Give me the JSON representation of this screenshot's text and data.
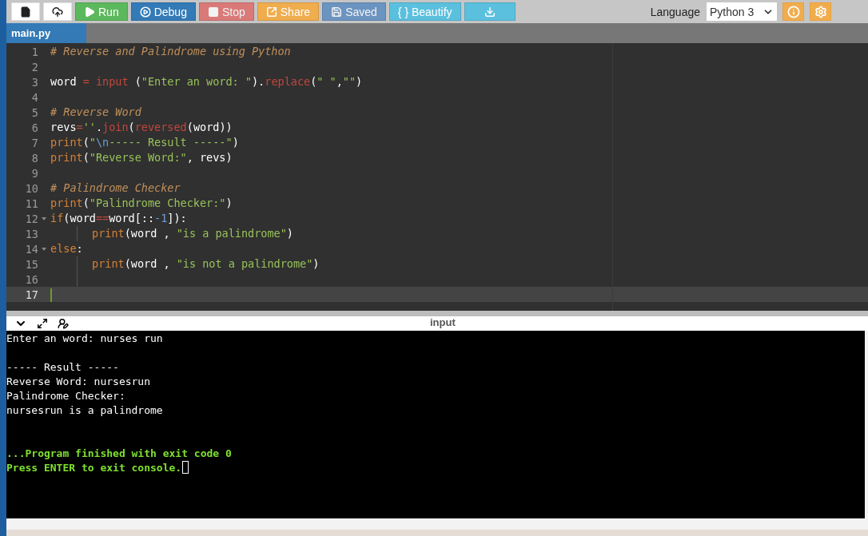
{
  "toolbar": {
    "buttons": [
      {
        "kind": "new-file",
        "color": "#ffffff",
        "disabled": false
      },
      {
        "kind": "upload",
        "color": "#ffffff",
        "disabled": false
      },
      {
        "kind": "run",
        "label": "Run",
        "color": "#5cb85c",
        "disabled": false
      },
      {
        "kind": "debug",
        "label": "Debug",
        "color": "#337ab7",
        "disabled": false
      },
      {
        "kind": "stop",
        "label": "Stop",
        "color": "#d97a78",
        "disabled": true
      },
      {
        "kind": "share",
        "label": "Share",
        "color": "#f0ad4e",
        "disabled": false
      },
      {
        "kind": "save",
        "label": "Saved",
        "color": "#6b94c0",
        "disabled": true
      },
      {
        "kind": "beautify",
        "label": "{ } Beautify",
        "color": "#5bc0de",
        "disabled": false
      },
      {
        "kind": "download",
        "color": "#5bc0de",
        "disabled": false
      }
    ],
    "language": {
      "label": "Language",
      "value": "Python 3"
    },
    "right_buttons": [
      {
        "kind": "info"
      },
      {
        "kind": "settings"
      }
    ]
  },
  "tabs": [
    {
      "label": "main.py",
      "selected": true
    }
  ],
  "editor": {
    "lines": [
      {
        "number": "1",
        "fold": false,
        "indented": false,
        "active": false,
        "tokens": [
          {
            "kind": "comment",
            "text": "# Reverse and Palindrome using Python"
          }
        ]
      },
      {
        "number": "2",
        "fold": false,
        "indented": false,
        "active": false
      },
      {
        "number": "3",
        "fold": false,
        "indented": false,
        "active": false,
        "tokens": [
          {
            "kind": "plain",
            "text": "word "
          },
          {
            "kind": "keyword",
            "text": "= input"
          },
          {
            "kind": "plain",
            "text": " ("
          },
          {
            "kind": "string",
            "text": "\"Enter an word: \""
          },
          {
            "kind": "plain",
            "text": ")."
          },
          {
            "kind": "keyword",
            "text": "replace"
          },
          {
            "kind": "plain",
            "text": "("
          },
          {
            "kind": "string",
            "text": "\" \""
          },
          {
            "kind": "plain",
            "text": ","
          },
          {
            "kind": "string",
            "text": "\"\""
          },
          {
            "kind": "plain",
            "text": ")"
          }
        ]
      },
      {
        "number": "4",
        "fold": false,
        "indented": false,
        "active": false
      },
      {
        "number": "5",
        "fold": false,
        "indented": false,
        "active": false,
        "tokens": [
          {
            "kind": "comment",
            "text": "# Reverse Word"
          }
        ]
      },
      {
        "number": "6",
        "fold": false,
        "indented": false,
        "active": false,
        "tokens": [
          {
            "kind": "plain",
            "text": "revs"
          },
          {
            "kind": "keyword",
            "text": "="
          },
          {
            "kind": "string",
            "text": "''"
          },
          {
            "kind": "plain",
            "text": "."
          },
          {
            "kind": "keyword",
            "text": "join"
          },
          {
            "kind": "plain",
            "text": "("
          },
          {
            "kind": "keyword",
            "text": "reversed"
          },
          {
            "kind": "plain",
            "text": "(word))"
          }
        ]
      },
      {
        "number": "7",
        "fold": false,
        "indented": false,
        "active": false,
        "tokens": [
          {
            "kind": "builtin",
            "text": "print"
          },
          {
            "kind": "plain",
            "text": "("
          },
          {
            "kind": "string",
            "text": "\""
          },
          {
            "kind": "escape",
            "text": "\\n"
          },
          {
            "kind": "string",
            "text": "----- Result -----\""
          },
          {
            "kind": "plain",
            "text": ")"
          }
        ]
      },
      {
        "number": "8",
        "fold": false,
        "indented": false,
        "active": false,
        "tokens": [
          {
            "kind": "builtin",
            "text": "print"
          },
          {
            "kind": "plain",
            "text": "("
          },
          {
            "kind": "string",
            "text": "\"Reverse Word:\""
          },
          {
            "kind": "plain",
            "text": ", revs)"
          }
        ]
      },
      {
        "number": "9",
        "fold": false,
        "indented": false,
        "active": false
      },
      {
        "number": "10",
        "fold": false,
        "indented": false,
        "active": false,
        "tokens": [
          {
            "kind": "comment",
            "text": "# Palindrome Checker"
          }
        ]
      },
      {
        "number": "11",
        "fold": false,
        "indented": false,
        "active": false,
        "tokens": [
          {
            "kind": "builtin",
            "text": "print"
          },
          {
            "kind": "plain",
            "text": "("
          },
          {
            "kind": "string",
            "text": "\"Palindrome Checker:\""
          },
          {
            "kind": "plain",
            "text": ")"
          }
        ]
      },
      {
        "number": "12",
        "fold": true,
        "indented": false,
        "active": false,
        "tokens": [
          {
            "kind": "builtin",
            "text": "if"
          },
          {
            "kind": "plain",
            "text": "(word"
          },
          {
            "kind": "keyword",
            "text": "=="
          },
          {
            "kind": "plain",
            "text": "word[::"
          },
          {
            "kind": "number",
            "text": "-1"
          },
          {
            "kind": "plain",
            "text": "]):"
          }
        ]
      },
      {
        "number": "13",
        "fold": false,
        "indented": true,
        "active": false,
        "tokens": [
          {
            "kind": "builtin",
            "text": "print"
          },
          {
            "kind": "plain",
            "text": "(word , "
          },
          {
            "kind": "string",
            "text": "\"is a palindrome\""
          },
          {
            "kind": "plain",
            "text": ")"
          }
        ]
      },
      {
        "number": "14",
        "fold": true,
        "indented": false,
        "active": false,
        "tokens": [
          {
            "kind": "builtin",
            "text": "else"
          },
          {
            "kind": "plain",
            "text": ":"
          }
        ]
      },
      {
        "number": "15",
        "fold": false,
        "indented": true,
        "active": false,
        "tokens": [
          {
            "kind": "builtin",
            "text": "print"
          },
          {
            "kind": "plain",
            "text": "(word , "
          },
          {
            "kind": "string",
            "text": "\"is not a palindrome\""
          },
          {
            "kind": "plain",
            "text": ")"
          }
        ]
      },
      {
        "number": "16",
        "fold": false,
        "indented": true,
        "active": false
      },
      {
        "number": "17",
        "fold": false,
        "indented": false,
        "active": true
      }
    ]
  },
  "console": {
    "title": "input",
    "lines": [
      {
        "kind": "output",
        "text": "Enter an word: nurses run"
      },
      {
        "kind": "blank"
      },
      {
        "kind": "output",
        "text": "----- Result -----"
      },
      {
        "kind": "output",
        "text": "Reverse Word: nursesrun"
      },
      {
        "kind": "output",
        "text": "Palindrome Checker:"
      },
      {
        "kind": "output",
        "text": "nursesrun is a palindrome"
      },
      {
        "kind": "blank"
      },
      {
        "kind": "blank"
      },
      {
        "kind": "status",
        "text": "...Program finished with exit code 0"
      },
      {
        "kind": "prompt",
        "text": "Press ENTER to exit console."
      }
    ]
  }
}
